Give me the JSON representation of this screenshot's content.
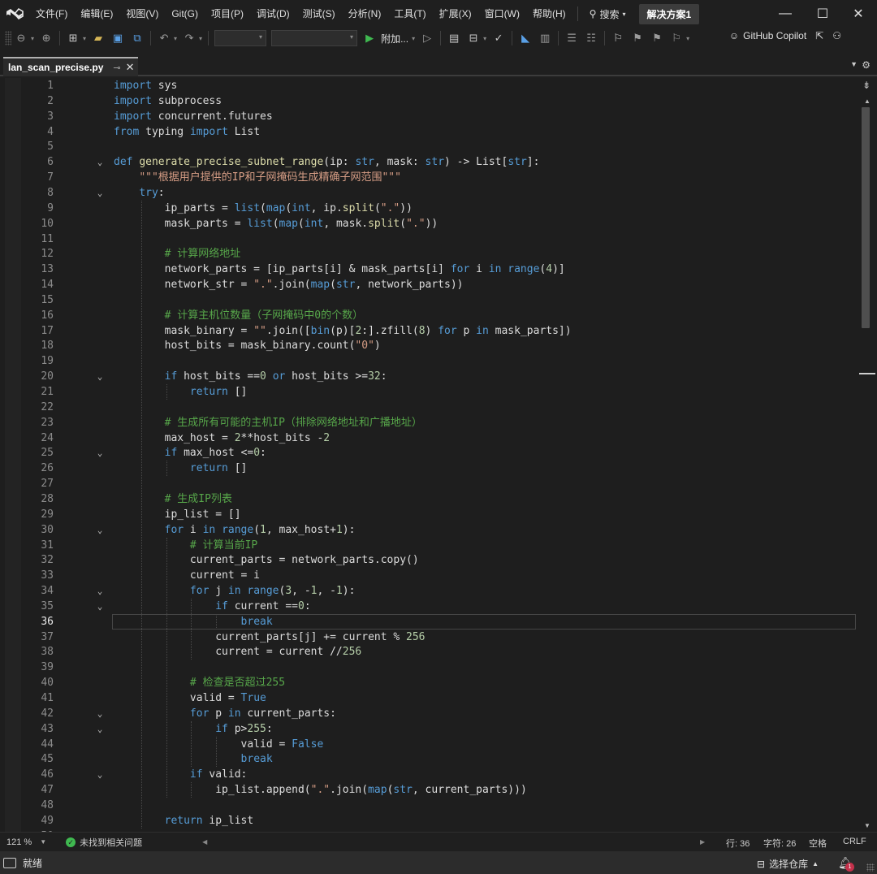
{
  "menubar": {
    "items": [
      "文件(F)",
      "编辑(E)",
      "视图(V)",
      "Git(G)",
      "项目(P)",
      "调试(D)",
      "测试(S)",
      "分析(N)",
      "工具(T)",
      "扩展(X)",
      "窗口(W)",
      "帮助(H)"
    ],
    "search_label": "搜索",
    "solution_name": "解决方案1"
  },
  "window_controls": {
    "minimize": "—",
    "maximize": "☐",
    "close": "✕"
  },
  "toolbar": {
    "attach_label": "附加...",
    "copilot_label": "GitHub Copilot"
  },
  "tab": {
    "filename": "lan_scan_precise.py",
    "pin_glyph": "⊸",
    "close_glyph": "✕"
  },
  "editor": {
    "current_line": 36,
    "lines": [
      {
        "n": 1,
        "fold": "",
        "tokens": [
          [
            "import",
            "kw"
          ],
          [
            " sys",
            ""
          ]
        ]
      },
      {
        "n": 2,
        "fold": "",
        "tokens": [
          [
            "import",
            "kw"
          ],
          [
            " subprocess",
            ""
          ]
        ]
      },
      {
        "n": 3,
        "fold": "",
        "tokens": [
          [
            "import",
            "kw"
          ],
          [
            " concurrent.futures",
            ""
          ]
        ]
      },
      {
        "n": 4,
        "fold": "",
        "tokens": [
          [
            "from",
            "kw"
          ],
          [
            " typing ",
            ""
          ],
          [
            "import",
            "kw"
          ],
          [
            " List",
            ""
          ]
        ]
      },
      {
        "n": 5,
        "fold": "",
        "tokens": []
      },
      {
        "n": 6,
        "fold": "v",
        "tokens": [
          [
            "def",
            "kw"
          ],
          [
            " ",
            ""
          ],
          [
            "generate_precise_subnet_range",
            "fn"
          ],
          [
            "(ip: ",
            ""
          ],
          [
            "str",
            "kw"
          ],
          [
            ", mask: ",
            ""
          ],
          [
            "str",
            "kw"
          ],
          [
            ") -> List[",
            ""
          ],
          [
            "str",
            "kw"
          ],
          [
            "]:",
            ""
          ]
        ]
      },
      {
        "n": 7,
        "fold": "",
        "tokens": [
          [
            "    ",
            ""
          ],
          [
            "\"\"\"根据用户提供的IP和子网掩码生成精确子网范围\"\"\"",
            "str"
          ]
        ]
      },
      {
        "n": 8,
        "fold": "v",
        "tokens": [
          [
            "    ",
            ""
          ],
          [
            "try",
            "kw"
          ],
          [
            ":",
            ""
          ]
        ]
      },
      {
        "n": 9,
        "fold": "",
        "tokens": [
          [
            "        ip_parts = ",
            ""
          ],
          [
            "list",
            "kw"
          ],
          [
            "(",
            ""
          ],
          [
            "map",
            "kw"
          ],
          [
            "(",
            ""
          ],
          [
            "int",
            "kw"
          ],
          [
            ", ip.",
            ""
          ],
          [
            "split",
            "fn"
          ],
          [
            "(",
            ""
          ],
          [
            "\".\"",
            "str"
          ],
          [
            "))",
            ""
          ]
        ]
      },
      {
        "n": 10,
        "fold": "",
        "tokens": [
          [
            "        mask_parts = ",
            ""
          ],
          [
            "list",
            "kw"
          ],
          [
            "(",
            ""
          ],
          [
            "map",
            "kw"
          ],
          [
            "(",
            ""
          ],
          [
            "int",
            "kw"
          ],
          [
            ", mask.",
            ""
          ],
          [
            "split",
            "fn"
          ],
          [
            "(",
            ""
          ],
          [
            "\".\"",
            "str"
          ],
          [
            "))",
            ""
          ]
        ]
      },
      {
        "n": 11,
        "fold": "",
        "tokens": []
      },
      {
        "n": 12,
        "fold": "",
        "tokens": [
          [
            "        ",
            ""
          ],
          [
            "# 计算网络地址",
            "cm"
          ]
        ]
      },
      {
        "n": 13,
        "fold": "",
        "tokens": [
          [
            "        network_parts = [ip_parts[i] & mask_parts[i] ",
            ""
          ],
          [
            "for",
            "kw"
          ],
          [
            " i ",
            ""
          ],
          [
            "in",
            "kw"
          ],
          [
            " ",
            ""
          ],
          [
            "range",
            "kw"
          ],
          [
            "(",
            ""
          ],
          [
            "4",
            "num"
          ],
          [
            ")]",
            ""
          ]
        ]
      },
      {
        "n": 14,
        "fold": "",
        "tokens": [
          [
            "        network_str = ",
            ""
          ],
          [
            "\".\"",
            "str"
          ],
          [
            ".join(",
            ""
          ],
          [
            "map",
            "kw"
          ],
          [
            "(",
            ""
          ],
          [
            "str",
            "kw"
          ],
          [
            ", network_parts))",
            ""
          ]
        ]
      },
      {
        "n": 15,
        "fold": "",
        "tokens": []
      },
      {
        "n": 16,
        "fold": "",
        "tokens": [
          [
            "        ",
            ""
          ],
          [
            "# 计算主机位数量（子网掩码中0的个数）",
            "cm"
          ]
        ]
      },
      {
        "n": 17,
        "fold": "",
        "tokens": [
          [
            "        mask_binary = ",
            ""
          ],
          [
            "\"\"",
            "str"
          ],
          [
            ".join([",
            ""
          ],
          [
            "bin",
            "kw"
          ],
          [
            "(p)[",
            ""
          ],
          [
            "2",
            "num"
          ],
          [
            ":].zfill(",
            ""
          ],
          [
            "8",
            "num"
          ],
          [
            ") ",
            ""
          ],
          [
            "for",
            "kw"
          ],
          [
            " p ",
            ""
          ],
          [
            "in",
            "kw"
          ],
          [
            " mask_parts])",
            ""
          ]
        ]
      },
      {
        "n": 18,
        "fold": "",
        "tokens": [
          [
            "        host_bits = mask_binary.count(",
            ""
          ],
          [
            "\"0\"",
            "str"
          ],
          [
            ")",
            ""
          ]
        ]
      },
      {
        "n": 19,
        "fold": "",
        "tokens": []
      },
      {
        "n": 20,
        "fold": "v",
        "tokens": [
          [
            "        ",
            ""
          ],
          [
            "if",
            "kw"
          ],
          [
            " host_bits ==",
            ""
          ],
          [
            "0",
            "num"
          ],
          [
            " ",
            ""
          ],
          [
            "or",
            "kw"
          ],
          [
            " host_bits >=",
            ""
          ],
          [
            "32",
            "num"
          ],
          [
            ":",
            ""
          ]
        ]
      },
      {
        "n": 21,
        "fold": "",
        "tokens": [
          [
            "            ",
            ""
          ],
          [
            "return",
            "kw"
          ],
          [
            " []",
            ""
          ]
        ]
      },
      {
        "n": 22,
        "fold": "",
        "tokens": []
      },
      {
        "n": 23,
        "fold": "",
        "tokens": [
          [
            "        ",
            ""
          ],
          [
            "# 生成所有可能的主机IP（排除网络地址和广播地址）",
            "cm"
          ]
        ]
      },
      {
        "n": 24,
        "fold": "",
        "tokens": [
          [
            "        max_host = ",
            ""
          ],
          [
            "2",
            "num"
          ],
          [
            "**host_bits -",
            ""
          ],
          [
            "2",
            "num"
          ]
        ]
      },
      {
        "n": 25,
        "fold": "v",
        "tokens": [
          [
            "        ",
            ""
          ],
          [
            "if",
            "kw"
          ],
          [
            " max_host <=",
            ""
          ],
          [
            "0",
            "num"
          ],
          [
            ":",
            ""
          ]
        ]
      },
      {
        "n": 26,
        "fold": "",
        "tokens": [
          [
            "            ",
            ""
          ],
          [
            "return",
            "kw"
          ],
          [
            " []",
            ""
          ]
        ]
      },
      {
        "n": 27,
        "fold": "",
        "tokens": []
      },
      {
        "n": 28,
        "fold": "",
        "tokens": [
          [
            "        ",
            ""
          ],
          [
            "# 生成IP列表",
            "cm"
          ]
        ]
      },
      {
        "n": 29,
        "fold": "",
        "tokens": [
          [
            "        ip_list = []",
            ""
          ]
        ]
      },
      {
        "n": 30,
        "fold": "v",
        "tokens": [
          [
            "        ",
            ""
          ],
          [
            "for",
            "kw"
          ],
          [
            " i ",
            ""
          ],
          [
            "in",
            "kw"
          ],
          [
            " ",
            ""
          ],
          [
            "range",
            "kw"
          ],
          [
            "(",
            ""
          ],
          [
            "1",
            "num"
          ],
          [
            ", max_host+",
            ""
          ],
          [
            "1",
            "num"
          ],
          [
            "):",
            ""
          ]
        ]
      },
      {
        "n": 31,
        "fold": "",
        "tokens": [
          [
            "            ",
            ""
          ],
          [
            "# 计算当前IP",
            "cm"
          ]
        ]
      },
      {
        "n": 32,
        "fold": "",
        "tokens": [
          [
            "            current_parts = network_parts.copy()",
            ""
          ]
        ]
      },
      {
        "n": 33,
        "fold": "",
        "tokens": [
          [
            "            current = i",
            ""
          ]
        ]
      },
      {
        "n": 34,
        "fold": "v",
        "tokens": [
          [
            "            ",
            ""
          ],
          [
            "for",
            "kw"
          ],
          [
            " j ",
            ""
          ],
          [
            "in",
            "kw"
          ],
          [
            " ",
            ""
          ],
          [
            "range",
            "kw"
          ],
          [
            "(",
            ""
          ],
          [
            "3",
            "num"
          ],
          [
            ", -",
            ""
          ],
          [
            "1",
            "num"
          ],
          [
            ", -",
            ""
          ],
          [
            "1",
            "num"
          ],
          [
            "):",
            ""
          ]
        ]
      },
      {
        "n": 35,
        "fold": "v",
        "tokens": [
          [
            "                ",
            ""
          ],
          [
            "if",
            "kw"
          ],
          [
            " current ==",
            ""
          ],
          [
            "0",
            "num"
          ],
          [
            ":",
            ""
          ]
        ]
      },
      {
        "n": 36,
        "fold": "",
        "tokens": [
          [
            "                    ",
            ""
          ],
          [
            "break",
            "kw"
          ]
        ]
      },
      {
        "n": 37,
        "fold": "",
        "tokens": [
          [
            "                current_parts[j] += current % ",
            ""
          ],
          [
            "256",
            "num"
          ]
        ]
      },
      {
        "n": 38,
        "fold": "",
        "tokens": [
          [
            "                current = current //",
            ""
          ],
          [
            "256",
            "num"
          ]
        ]
      },
      {
        "n": 39,
        "fold": "",
        "tokens": []
      },
      {
        "n": 40,
        "fold": "",
        "tokens": [
          [
            "            ",
            ""
          ],
          [
            "# 检查是否超过255",
            "cm"
          ]
        ]
      },
      {
        "n": 41,
        "fold": "",
        "tokens": [
          [
            "            valid = ",
            ""
          ],
          [
            "True",
            "kw"
          ]
        ]
      },
      {
        "n": 42,
        "fold": "v",
        "tokens": [
          [
            "            ",
            ""
          ],
          [
            "for",
            "kw"
          ],
          [
            " p ",
            ""
          ],
          [
            "in",
            "kw"
          ],
          [
            " current_parts:",
            ""
          ]
        ]
      },
      {
        "n": 43,
        "fold": "v",
        "tokens": [
          [
            "                ",
            ""
          ],
          [
            "if",
            "kw"
          ],
          [
            " p>",
            ""
          ],
          [
            "255",
            "num"
          ],
          [
            ":",
            ""
          ]
        ]
      },
      {
        "n": 44,
        "fold": "",
        "tokens": [
          [
            "                    valid = ",
            ""
          ],
          [
            "False",
            "kw"
          ]
        ]
      },
      {
        "n": 45,
        "fold": "",
        "tokens": [
          [
            "                    ",
            ""
          ],
          [
            "break",
            "kw"
          ]
        ]
      },
      {
        "n": 46,
        "fold": "v",
        "tokens": [
          [
            "            ",
            ""
          ],
          [
            "if",
            "kw"
          ],
          [
            " valid:",
            ""
          ]
        ]
      },
      {
        "n": 47,
        "fold": "",
        "tokens": [
          [
            "                ip_list.append(",
            ""
          ],
          [
            "\".\"",
            "str"
          ],
          [
            ".join(",
            ""
          ],
          [
            "map",
            "kw"
          ],
          [
            "(",
            ""
          ],
          [
            "str",
            "kw"
          ],
          [
            ", current_parts)))",
            ""
          ]
        ]
      },
      {
        "n": 48,
        "fold": "",
        "tokens": []
      },
      {
        "n": 49,
        "fold": "",
        "tokens": [
          [
            "        ",
            ""
          ],
          [
            "return",
            "kw"
          ],
          [
            " ip_list",
            ""
          ]
        ]
      },
      {
        "n": 50,
        "fold": "",
        "tokens": []
      }
    ]
  },
  "status": {
    "zoom": "121 %",
    "issues_label": "未找到相关问题",
    "line_label": "行: 36",
    "char_label": "字符: 26",
    "whitespace_label": "空格",
    "eol_label": "CRLF"
  },
  "bottom_status": {
    "ready_label": "就绪",
    "repo_label": "选择仓库",
    "notification_count": "1"
  },
  "colors": {
    "keyword": "#569cd6",
    "function": "#dcdcaa",
    "string": "#d69d85",
    "number": "#b5cea8",
    "comment": "#57a64a",
    "text": "#dcdcdc",
    "background": "#1e1e1e"
  }
}
